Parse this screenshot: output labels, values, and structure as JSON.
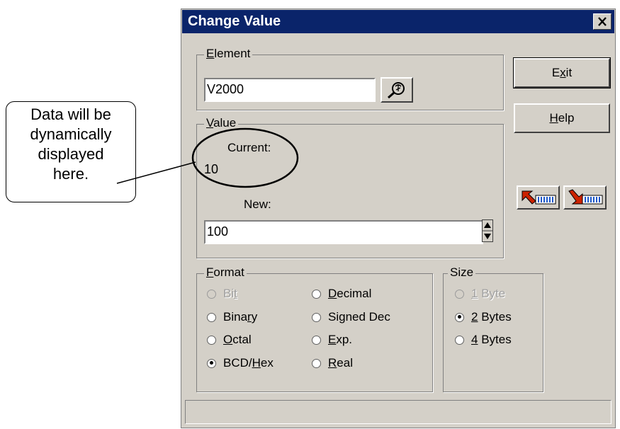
{
  "callout": {
    "line1": "Data will be",
    "line2": "dynamically",
    "line3": "displayed",
    "line4": "here."
  },
  "dialog": {
    "title": "Change Value",
    "element_group": {
      "label_u": "E",
      "label_rest": "lement",
      "value": "V2000"
    },
    "value_group": {
      "label_u": "V",
      "label_rest": "alue",
      "current_label": "Current:",
      "current_value": "10",
      "new_label": "New:",
      "new_value": "100"
    },
    "buttons": {
      "exit_a": "E",
      "exit_u": "x",
      "exit_b": "it",
      "help_u": "H",
      "help_rest": "elp"
    },
    "format_group": {
      "label_u": "F",
      "label_rest": "ormat",
      "options": [
        {
          "a": "Bi",
          "u": "t",
          "b": "",
          "enabled": false,
          "selected": false
        },
        {
          "a": "",
          "u": "D",
          "b": "ecimal",
          "enabled": true,
          "selected": false
        },
        {
          "a": "Bina",
          "u": "r",
          "b": "y",
          "enabled": true,
          "selected": false
        },
        {
          "a": "Signed Dec",
          "u": "",
          "b": "",
          "enabled": true,
          "selected": false
        },
        {
          "a": "",
          "u": "O",
          "b": "ctal",
          "enabled": true,
          "selected": false
        },
        {
          "a": "",
          "u": "E",
          "b": "xp.",
          "enabled": true,
          "selected": false
        },
        {
          "a": "BCD/",
          "u": "H",
          "b": "ex",
          "enabled": true,
          "selected": true
        },
        {
          "a": "",
          "u": "R",
          "b": "eal",
          "enabled": true,
          "selected": false
        }
      ]
    },
    "size_group": {
      "label": "Size",
      "options": [
        {
          "u": "1",
          "b": " Byte",
          "enabled": false,
          "selected": false
        },
        {
          "u": "2",
          "b": " Bytes",
          "enabled": true,
          "selected": true
        },
        {
          "u": "4",
          "b": " Bytes",
          "enabled": true,
          "selected": false
        }
      ]
    }
  },
  "colors": {
    "title_bar": "#0a246a",
    "dialog_bg": "#d4d0c8",
    "arrow_red": "#cc2200"
  }
}
